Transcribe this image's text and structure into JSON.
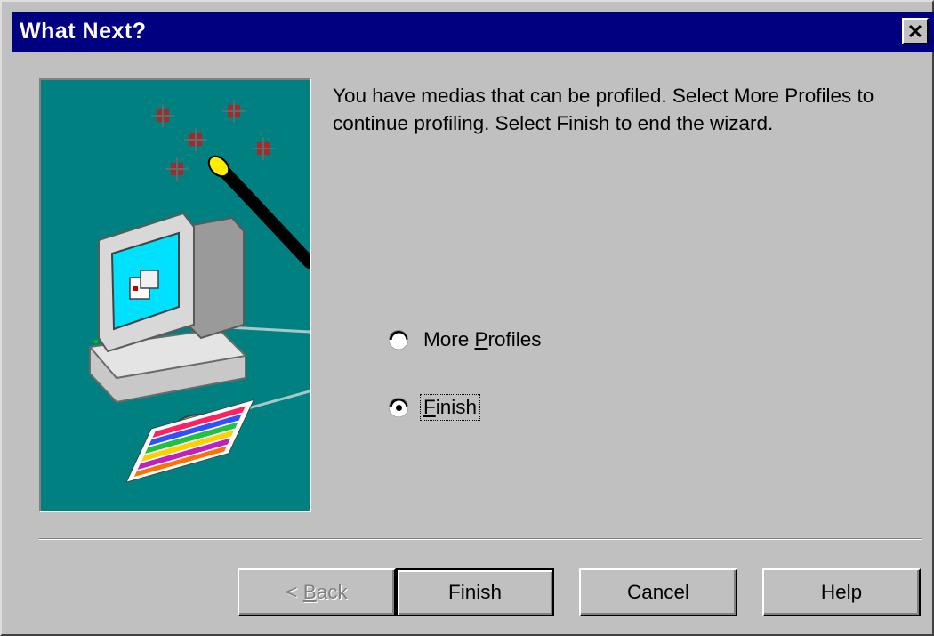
{
  "dialog": {
    "title": "What Next?",
    "message": "You have medias that can be profiled.  Select More Profiles to continue profiling.  Select Finish to end the wizard."
  },
  "options": [
    {
      "label_pre": "More ",
      "mnemonic": "P",
      "label_post": "rofiles",
      "selected": false
    },
    {
      "label_pre": "",
      "mnemonic": "F",
      "label_post": "inish",
      "selected": true
    }
  ],
  "buttons": {
    "back_pre": "< ",
    "back_mnemonic": "B",
    "back_post": "ack",
    "finish": "Finish",
    "cancel": "Cancel",
    "help": "Help"
  },
  "icons": [
    "close-icon",
    "wizard-illustration"
  ],
  "colors": {
    "titlebar": "#000080",
    "face": "#c0c0c0",
    "illustration_bg": "#008080"
  }
}
